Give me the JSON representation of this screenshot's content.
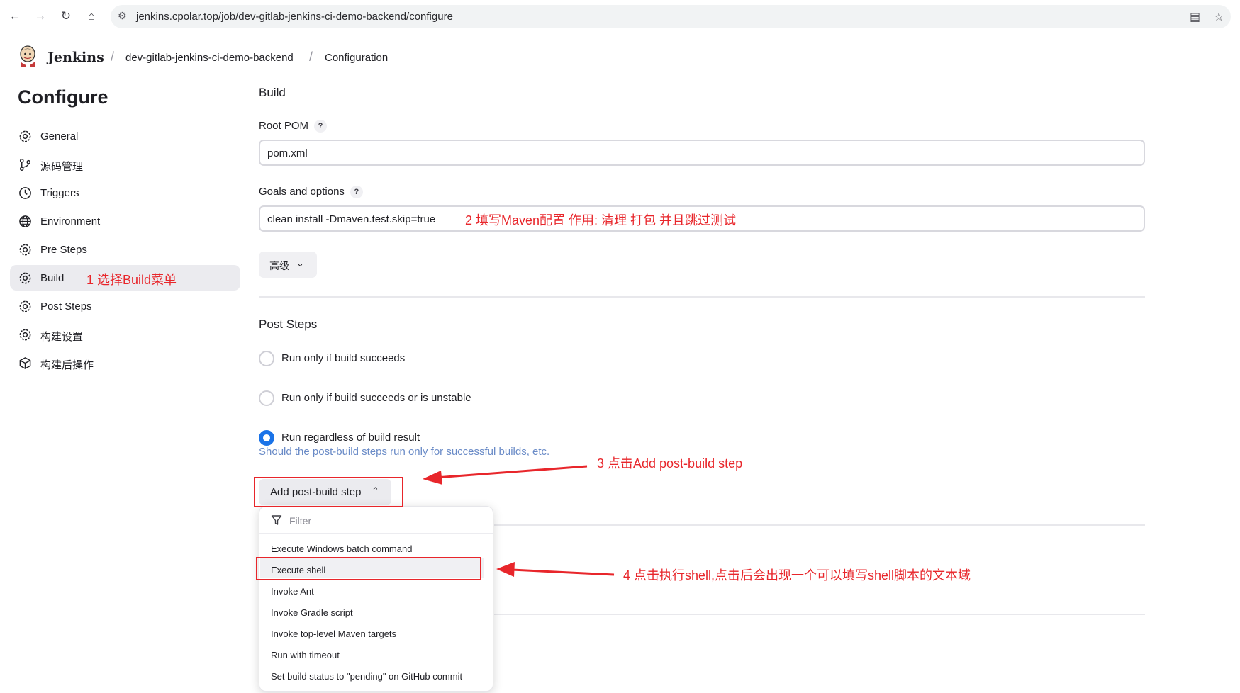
{
  "browser": {
    "url": "jenkins.cpolar.top/job/dev-gitlab-jenkins-ci-demo-backend/configure"
  },
  "header": {
    "brand": "Jenkins",
    "breadcrumbs": [
      "dev-gitlab-jenkins-ci-demo-backend",
      "Configuration"
    ]
  },
  "sidebar": {
    "title": "Configure",
    "items": [
      {
        "label": "General",
        "icon": "gear-icon"
      },
      {
        "label": "源码管理",
        "icon": "branch-icon"
      },
      {
        "label": "Triggers",
        "icon": "clock-icon"
      },
      {
        "label": "Environment",
        "icon": "globe-icon"
      },
      {
        "label": "Pre Steps",
        "icon": "gear-icon"
      },
      {
        "label": "Build",
        "icon": "gear-icon",
        "active": true
      },
      {
        "label": "Post Steps",
        "icon": "gear-icon"
      },
      {
        "label": "构建设置",
        "icon": "gear-icon"
      },
      {
        "label": "构建后操作",
        "icon": "cube-icon"
      }
    ]
  },
  "build": {
    "title": "Build",
    "root_pom_label": "Root POM",
    "root_pom_value": "pom.xml",
    "goals_label": "Goals and options",
    "goals_value": "clean install -Dmaven.test.skip=true",
    "advanced_label": "高级",
    "help_symbol": "?"
  },
  "post_steps": {
    "title": "Post Steps",
    "options": [
      {
        "label": "Run only if build succeeds",
        "checked": false
      },
      {
        "label": "Run only if build succeeds or is unstable",
        "checked": false
      },
      {
        "label": "Run regardless of build result",
        "checked": true
      }
    ],
    "description": "Should the post-build steps run only for successful builds, etc.",
    "add_button_label": "Add post-build step"
  },
  "dropdown": {
    "filter_placeholder": "Filter",
    "items": [
      "Execute Windows batch command",
      "Execute shell",
      "Invoke Ant",
      "Invoke Gradle script",
      "Invoke top-level Maven targets",
      "Run with timeout",
      "Set build status to \"pending\" on GitHub commit"
    ],
    "highlighted_index": 1
  },
  "annotations": {
    "step1": "1 选择Build菜单",
    "step2": "2 填写Maven配置  作用:  清理 打包 并且跳过测试",
    "step3": "3 点击Add post-build step",
    "step4": "4 点击执行shell,点击后会出现一个可以填写shell脚本的文本域"
  },
  "colors": {
    "accent": "#1a73e8",
    "annotation": "#e8262b",
    "active_bg": "#ebebef"
  }
}
